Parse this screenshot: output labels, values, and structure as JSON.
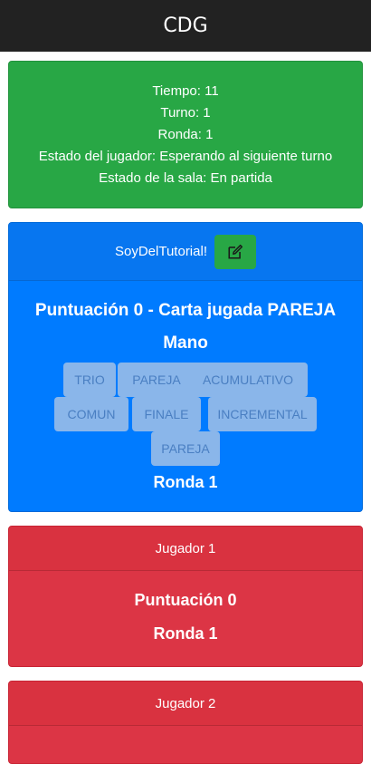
{
  "navbar": {
    "title": "CDG"
  },
  "status": {
    "tiempo": "Tiempo: 11",
    "turno": "Turno: 1",
    "ronda": "Ronda: 1",
    "estado_jugador": "Estado del jugador: Esperando al siguiente turno",
    "estado_sala": "Estado de la sala: En partida"
  },
  "self_player": {
    "name": "SoyDelTutorial!",
    "edit_icon": "pencil-square-icon",
    "score_line": "Puntuación 0 - Carta jugada PAREJA",
    "hand_label": "Mano",
    "cards": [
      "TRIO",
      "PAREJA",
      "ACUMULATIVO",
      "COMUN",
      "FINALE",
      "INCREMENTAL",
      "PAREJA"
    ],
    "round": "Ronda 1"
  },
  "players": [
    {
      "name": "Jugador 1",
      "score": "Puntuación 0",
      "round": "Ronda 1"
    },
    {
      "name": "Jugador 2"
    }
  ],
  "colors": {
    "navbar": "#222222",
    "success": "#28a745",
    "primary": "#007bff",
    "danger": "#dc3545",
    "card_chip": "#8ab6ea"
  }
}
